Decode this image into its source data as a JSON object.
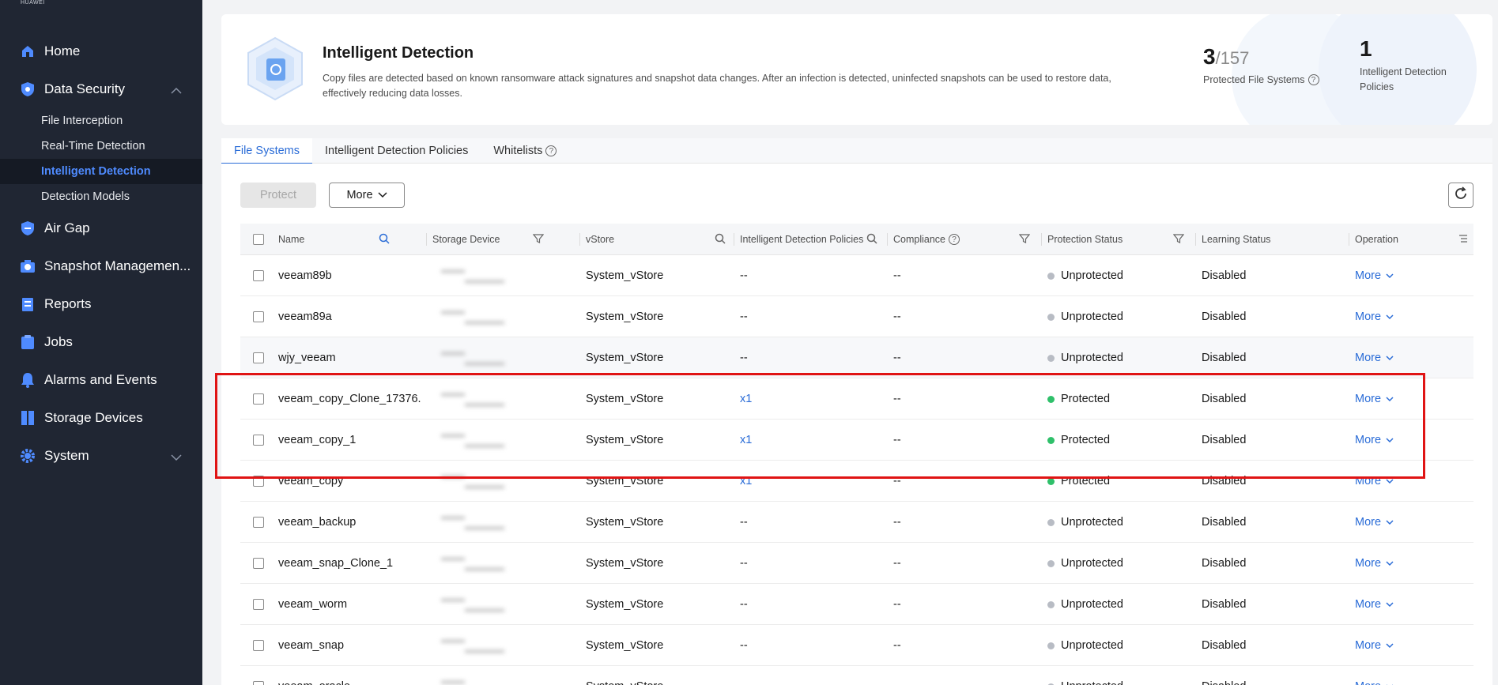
{
  "brand": "HUAWEI",
  "colors": {
    "accent": "#2a6cd7",
    "protected": "#2fc06a",
    "unprotected": "#b8bcc4",
    "highlight": "#e01414",
    "sidebar": "#202633"
  },
  "sidebar": {
    "items": [
      {
        "label": "Home",
        "icon": "home-icon"
      },
      {
        "label": "Data Security",
        "icon": "shield-icon"
      },
      {
        "label": "Air Gap",
        "icon": "air-gap-shield-icon"
      },
      {
        "label": "Snapshot Managemen...",
        "icon": "camera-icon"
      },
      {
        "label": "Reports",
        "icon": "report-icon"
      },
      {
        "label": "Jobs",
        "icon": "jobs-icon"
      },
      {
        "label": "Alarms and Events",
        "icon": "bell-icon"
      },
      {
        "label": "Storage Devices",
        "icon": "storage-icon"
      },
      {
        "label": "System",
        "icon": "gear-icon"
      }
    ],
    "sub_items": [
      "File Interception",
      "Real-Time Detection",
      "Intelligent Detection",
      "Detection Models"
    ]
  },
  "header": {
    "title": "Intelligent Detection",
    "description": "Copy files are detected based on known ransomware attack signatures and snapshot data changes. After an infection is detected, uninfected snapshots can be used to restore data, effectively reducing data losses.",
    "stat1_value": "3",
    "stat1_total": "/157",
    "stat1_label": "Protected File Systems",
    "stat2_value": "1",
    "stat2_label": "Intelligent Detection Policies"
  },
  "tabs": [
    "File Systems",
    "Intelligent Detection Policies",
    "Whitelists"
  ],
  "toolbar": {
    "protect_label": "Protect",
    "more_label": "More"
  },
  "table": {
    "columns": [
      "Name",
      "Storage Device",
      "vStore",
      "Intelligent Detection Policies",
      "Compliance",
      "Protection Status",
      "Learning Status",
      "Operation"
    ],
    "rows": [
      {
        "name": "veeam89b",
        "vstore": "System_vStore",
        "policy": "--",
        "compliance": "--",
        "status": "Unprotected",
        "learning": "Disabled",
        "op": "More"
      },
      {
        "name": "veeam89a",
        "vstore": "System_vStore",
        "policy": "--",
        "compliance": "--",
        "status": "Unprotected",
        "learning": "Disabled",
        "op": "More"
      },
      {
        "name": "wjy_veeam",
        "vstore": "System_vStore",
        "policy": "--",
        "compliance": "--",
        "status": "Unprotected",
        "learning": "Disabled",
        "op": "More"
      },
      {
        "name": "veeam_copy_Clone_17376...",
        "vstore": "System_vStore",
        "policy": "x1",
        "compliance": "--",
        "status": "Protected",
        "learning": "Disabled",
        "op": "More"
      },
      {
        "name": "veeam_copy_1",
        "vstore": "System_vStore",
        "policy": "x1",
        "compliance": "--",
        "status": "Protected",
        "learning": "Disabled",
        "op": "More"
      },
      {
        "name": "veeam_copy",
        "vstore": "System_vStore",
        "policy": "x1",
        "compliance": "--",
        "status": "Protected",
        "learning": "Disabled",
        "op": "More"
      },
      {
        "name": "veeam_backup",
        "vstore": "System_vStore",
        "policy": "--",
        "compliance": "--",
        "status": "Unprotected",
        "learning": "Disabled",
        "op": "More"
      },
      {
        "name": "veeam_snap_Clone_1",
        "vstore": "System_vStore",
        "policy": "--",
        "compliance": "--",
        "status": "Unprotected",
        "learning": "Disabled",
        "op": "More"
      },
      {
        "name": "veeam_worm",
        "vstore": "System_vStore",
        "policy": "--",
        "compliance": "--",
        "status": "Unprotected",
        "learning": "Disabled",
        "op": "More"
      },
      {
        "name": "veeam_snap",
        "vstore": "System_vStore",
        "policy": "--",
        "compliance": "--",
        "status": "Unprotected",
        "learning": "Disabled",
        "op": "More"
      },
      {
        "name": "veeam_oracle",
        "vstore": "System_vStore",
        "policy": "--",
        "compliance": "--",
        "status": "Unprotected",
        "learning": "Disabled",
        "op": "More"
      }
    ]
  }
}
